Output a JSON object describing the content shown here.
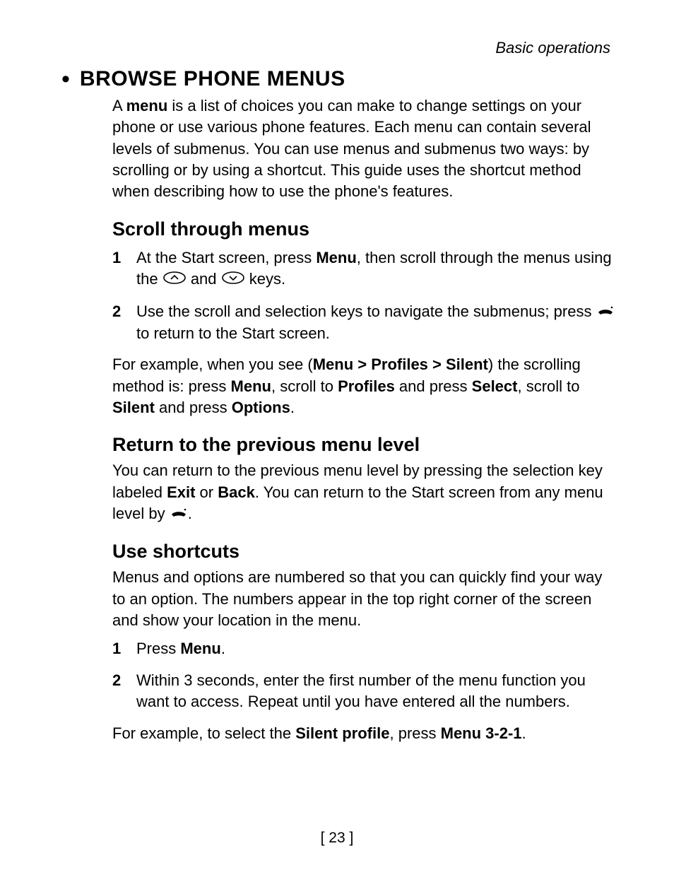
{
  "header": {
    "running": "Basic operations"
  },
  "title": "BROWSE PHONE MENUS",
  "intro": {
    "pre": "A ",
    "bold": "menu",
    "post": " is a list of choices you can make to change settings on your phone or use various phone features. Each menu can contain several levels of submenus. You can use menus and submenus two ways: by scrolling or by using a shortcut. This guide uses the shortcut method when describing how to use the phone's features."
  },
  "scroll": {
    "heading": "Scroll through menus",
    "step1": {
      "num": "1",
      "a": "At the Start screen, press ",
      "b": "Menu",
      "c": ", then scroll through the menus using the ",
      "d": " and ",
      "e": " keys."
    },
    "step2": {
      "num": "2",
      "a": "Use the scroll and selection keys to navigate the submenus; press ",
      "b": " to return to the Start screen."
    },
    "example": {
      "a": "For example, when you see (",
      "b": "Menu > Profiles > Silent",
      "c": ") the scrolling method is: press ",
      "d": "Menu",
      "e": ", scroll to ",
      "f": "Profiles",
      "g": " and press ",
      "h": "Select",
      "i": ", scroll to ",
      "j": "Silent",
      "k": " and press ",
      "l": "Options",
      "m": "."
    }
  },
  "return": {
    "heading": "Return to the previous menu level",
    "a": "You can return to the previous menu level by pressing the selection key labeled ",
    "b": "Exit",
    "c": " or ",
    "d": "Back",
    "e": ". You can return to the Start screen from any menu level by ",
    "f": "."
  },
  "shortcuts": {
    "heading": "Use shortcuts",
    "intro": "Menus and options are numbered so that you can quickly find your way to an option. The numbers appear in the top right corner of the screen and show your location in the menu.",
    "step1": {
      "num": "1",
      "a": "Press ",
      "b": "Menu",
      "c": "."
    },
    "step2": {
      "num": "2",
      "a": "Within 3 seconds, enter the first number of the menu function you want to access. Repeat until you have entered all the numbers."
    },
    "example": {
      "a": "For example, to select the ",
      "b": "Silent profile",
      "c": ", press ",
      "d": "Menu 3-2-1",
      "e": "."
    }
  },
  "page_number": "[ 23 ]"
}
